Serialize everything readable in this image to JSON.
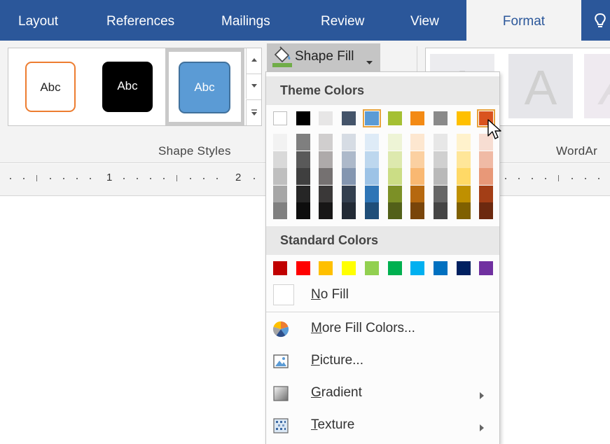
{
  "tabs": [
    {
      "label": "Layout"
    },
    {
      "label": "References"
    },
    {
      "label": "Mailings"
    },
    {
      "label": "Review"
    },
    {
      "label": "View"
    },
    {
      "label": "Format",
      "active": true
    }
  ],
  "tell_me_icon": "lightbulb-icon",
  "ribbon": {
    "shape_styles": {
      "group_label": "Shape Styles",
      "swatches": [
        {
          "text": "Abc",
          "fill": "#ffffff",
          "border": "#ed7d31",
          "text_color": "#222222"
        },
        {
          "text": "Abc",
          "fill": "#000000",
          "border": "#000000",
          "text_color": "#ffffff"
        },
        {
          "text": "Abc",
          "fill": "#5b9bd5",
          "border": "#41719c",
          "text_color": "#ffffff",
          "selected": true
        }
      ]
    },
    "shape_fill": {
      "label": "Shape Fill",
      "icon": "paint-bucket-icon",
      "fill_color": "#70ad47"
    },
    "wordart": {
      "group_label": "WordAr",
      "letters": [
        "A",
        "A",
        "A"
      ]
    }
  },
  "ruler": {
    "numbers": [
      "1",
      "2"
    ]
  },
  "dropdown": {
    "theme_colors_label": "Theme Colors",
    "theme_top_row": [
      "#ffffff",
      "#000000",
      "#e7e6e6",
      "#44546a",
      "#5b9bd5",
      "#a5c033",
      "#f38a14",
      "#8a8a8a",
      "#ffc000",
      "#d9531e"
    ],
    "theme_selected_index": 9,
    "theme_hover_index": 4,
    "theme_shades": [
      [
        "#f2f2f2",
        "#d9d9d9",
        "#bfbfbf",
        "#a6a6a6",
        "#808080"
      ],
      [
        "#7f7f7f",
        "#595959",
        "#3f3f3f",
        "#262626",
        "#0d0d0d"
      ],
      [
        "#d0cece",
        "#aeaaaa",
        "#757171",
        "#3a3838",
        "#171616"
      ],
      [
        "#d6dce4",
        "#adb9ca",
        "#8496b0",
        "#333f4f",
        "#222a35"
      ],
      [
        "#deebf7",
        "#bdd7ee",
        "#9dc3e6",
        "#2e75b6",
        "#1f4e79"
      ],
      [
        "#eef4d6",
        "#dde9ae",
        "#cbdd85",
        "#7c9026",
        "#526019"
      ],
      [
        "#fde7d0",
        "#fbd0a1",
        "#f9b872",
        "#b6680f",
        "#79450a"
      ],
      [
        "#e7e7e7",
        "#d0d0d0",
        "#b9b9b9",
        "#676767",
        "#454545"
      ],
      [
        "#fff2cc",
        "#ffe699",
        "#ffd966",
        "#bf9000",
        "#7f6000"
      ],
      [
        "#f7ddd2",
        "#f0baa5",
        "#e89878",
        "#a33e16",
        "#6c290f"
      ]
    ],
    "standard_colors_label": "Standard Colors",
    "standard_colors": [
      "#c00000",
      "#ff0000",
      "#ffc000",
      "#ffff00",
      "#92d050",
      "#00b050",
      "#00b0f0",
      "#0070c0",
      "#002060",
      "#7030a0"
    ],
    "no_fill": {
      "mnemonic": "N",
      "rest": "o Fill"
    },
    "items": [
      {
        "name": "more-fill-colors",
        "icon": "color-wheel-icon",
        "mnemonic": "M",
        "rest": "ore Fill Colors...",
        "submenu": false
      },
      {
        "name": "picture",
        "icon": "picture-icon",
        "mnemonic": "P",
        "rest": "icture...",
        "submenu": false
      },
      {
        "name": "gradient",
        "icon": "gradient-icon",
        "mnemonic": "G",
        "rest": "radient",
        "submenu": true
      },
      {
        "name": "texture",
        "icon": "texture-icon",
        "mnemonic": "T",
        "rest": "exture",
        "submenu": true
      }
    ]
  }
}
